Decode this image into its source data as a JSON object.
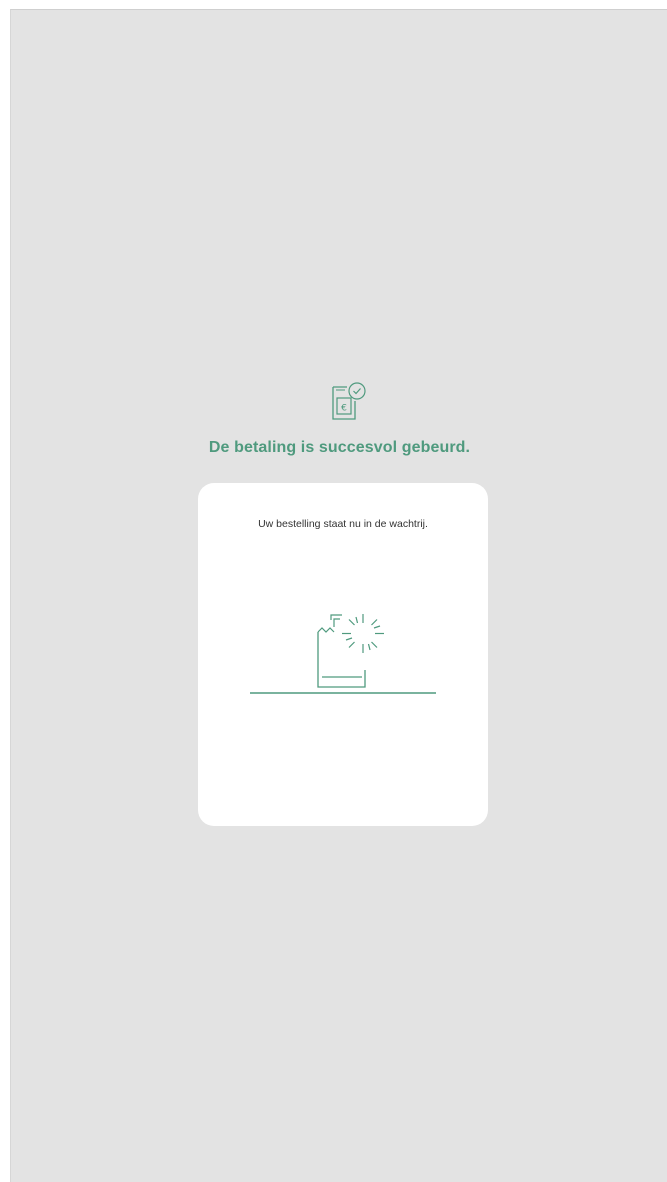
{
  "status": {
    "icon": "receipt-euro-check-icon",
    "title": "De betaling is succesvol gebeurd."
  },
  "order_card": {
    "message": "Uw bestelling staat nu in de wachtrij.",
    "illustration": "receipt-printer-icon"
  },
  "colors": {
    "accent": "#4f9a7e",
    "background": "#e3e3e3",
    "card": "#ffffff"
  }
}
